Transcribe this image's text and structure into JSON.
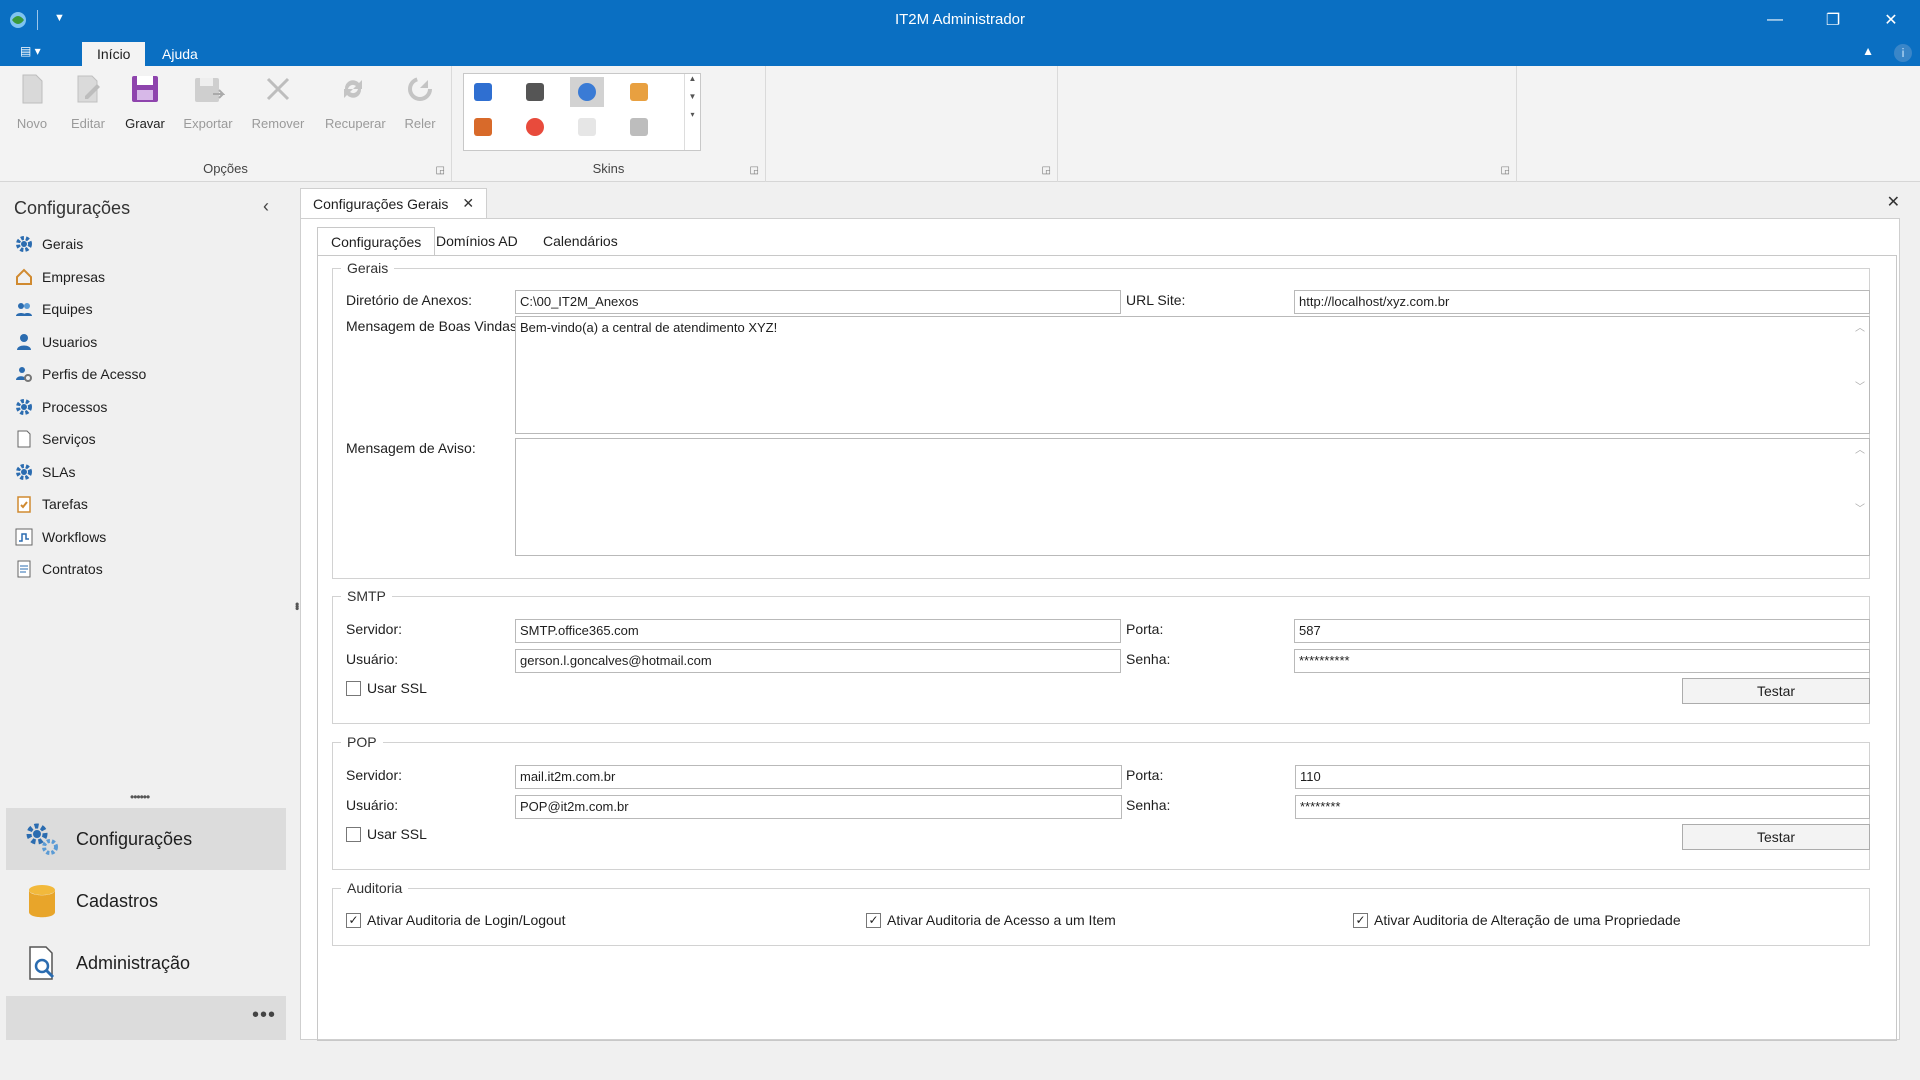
{
  "window": {
    "title": "IT2M Administrador"
  },
  "ribbon": {
    "tabs": [
      {
        "label": "Início"
      },
      {
        "label": "Ajuda"
      }
    ],
    "groups": {
      "opcoes": {
        "label": "Opções",
        "buttons": [
          {
            "label": "Novo",
            "enabled": false
          },
          {
            "label": "Editar",
            "enabled": false
          },
          {
            "label": "Gravar",
            "enabled": true
          },
          {
            "label": "Exportar",
            "enabled": false
          },
          {
            "label": "Remover",
            "enabled": false
          },
          {
            "label": "Recuperar",
            "enabled": false
          },
          {
            "label": "Reler",
            "enabled": false
          }
        ]
      },
      "skins": {
        "label": "Skins"
      }
    }
  },
  "sidebar": {
    "header": "Configurações",
    "items": [
      {
        "label": "Gerais",
        "icon": "gear-icon"
      },
      {
        "label": "Empresas",
        "icon": "home-icon"
      },
      {
        "label": "Equipes",
        "icon": "group-icon"
      },
      {
        "label": "Usuarios",
        "icon": "user-icon"
      },
      {
        "label": "Perfis de Acesso",
        "icon": "user-gear-icon"
      },
      {
        "label": "Processos",
        "icon": "gear-icon"
      },
      {
        "label": "Serviços",
        "icon": "document-icon"
      },
      {
        "label": "SLAs",
        "icon": "gear-icon"
      },
      {
        "label": "Tarefas",
        "icon": "clipboard-check-icon"
      },
      {
        "label": "Workflows",
        "icon": "workflow-icon"
      },
      {
        "label": "Contratos",
        "icon": "contract-icon"
      }
    ],
    "groups": [
      {
        "label": "Configurações",
        "icon": "gears-icon",
        "active": true
      },
      {
        "label": "Cadastros",
        "icon": "database-icon",
        "active": false
      },
      {
        "label": "Administração",
        "icon": "document-search-icon",
        "active": false
      }
    ]
  },
  "document": {
    "tab_label": "Configurações Gerais",
    "inner_tabs": [
      {
        "label": "Configurações"
      },
      {
        "label": "Domínios AD"
      },
      {
        "label": "Calendários"
      }
    ],
    "gerais": {
      "legend": "Gerais",
      "dir_anexos_label": "Diretório de Anexos:",
      "dir_anexos_value": "C:\\00_IT2M_Anexos",
      "url_site_label": "URL Site:",
      "url_site_value": "http://localhost/xyz.com.br",
      "boas_vindas_label": "Mensagem de Boas Vindas:",
      "boas_vindas_value": "Bem-vindo(a) a central de atendimento XYZ!",
      "aviso_label": "Mensagem de Aviso:",
      "aviso_value": ""
    },
    "smtp": {
      "legend": "SMTP",
      "servidor_label": "Servidor:",
      "servidor_value": "SMTP.office365.com",
      "porta_label": "Porta:",
      "porta_value": "587",
      "usuario_label": "Usuário:",
      "usuario_value": "gerson.l.goncalves@hotmail.com",
      "senha_label": "Senha:",
      "senha_value": "**********",
      "ssl_label": "Usar SSL",
      "ssl_checked": false,
      "testar_label": "Testar"
    },
    "pop": {
      "legend": "POP",
      "servidor_label": "Servidor:",
      "servidor_value": "mail.it2m.com.br",
      "porta_label": "Porta:",
      "porta_value": "110",
      "usuario_label": "Usuário:",
      "usuario_value": "POP@it2m.com.br",
      "senha_label": "Senha:",
      "senha_value": "********",
      "ssl_label": "Usar SSL",
      "ssl_checked": false,
      "testar_label": "Testar"
    },
    "auditoria": {
      "legend": "Auditoria",
      "login_label": "Ativar Auditoria de Login/Logout",
      "login_checked": true,
      "acesso_label": "Ativar Auditoria de Acesso a um Item",
      "acesso_checked": true,
      "alteracao_label": "Ativar Auditoria de Alteração de uma Propriedade",
      "alteracao_checked": true
    }
  },
  "colors": {
    "titlebar": "#0a6fc2",
    "accent_purple": "#8e44ad",
    "icon_blue": "#2b6cb0"
  }
}
